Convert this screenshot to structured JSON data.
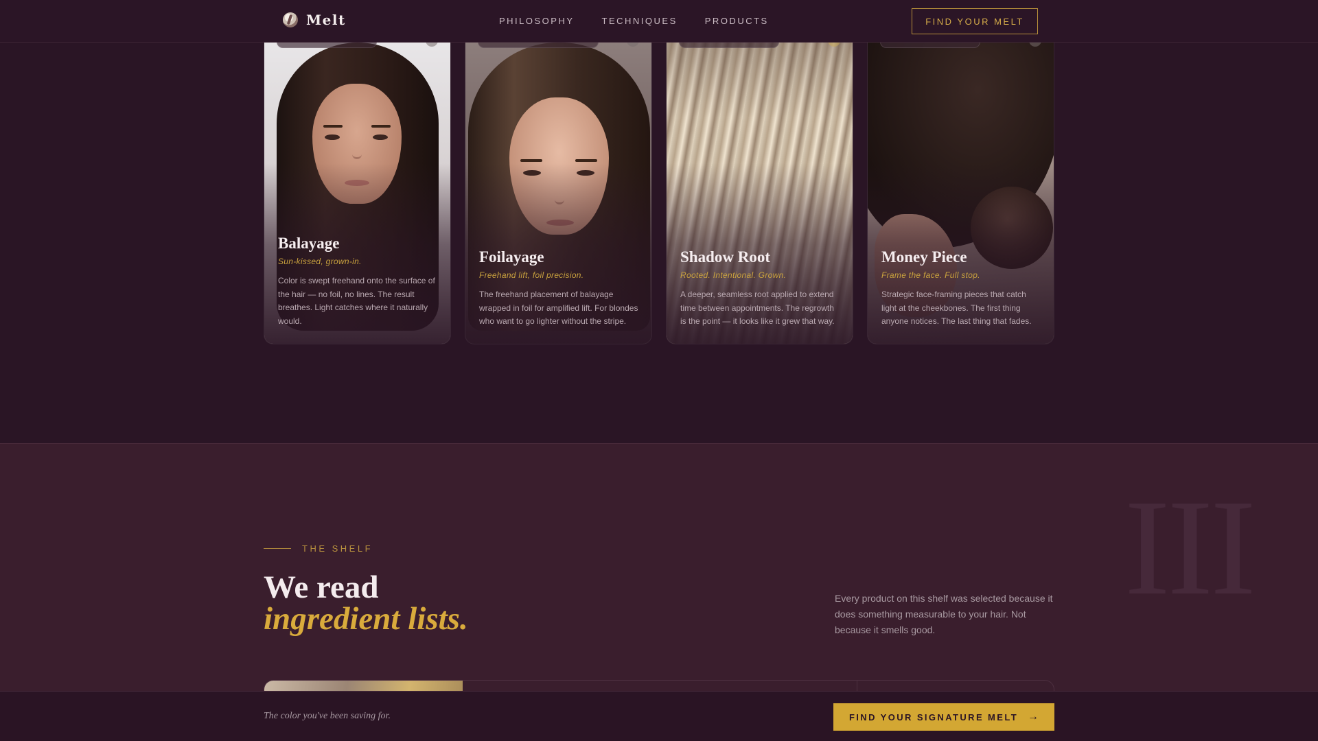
{
  "brand": {
    "name": "Melt",
    "logo_icon": "melt-flame-logo"
  },
  "nav": {
    "links": [
      "PHILOSOPHY",
      "TECHNIQUES",
      "PRODUCTS"
    ],
    "cta": "FIND YOUR MELT"
  },
  "techniques": [
    {
      "title": "Balayage",
      "subtitle": "Sun-kissed, grown-in.",
      "description": "Color is swept freehand onto the surface of the hair — no foil, no lines. The result breathes. Light catches where it naturally would."
    },
    {
      "title": "Foilayage",
      "subtitle": "Freehand lift, foil precision.",
      "description": "The freehand placement of balayage wrapped in foil for amplified lift. For blondes who want to go lighter without the stripe."
    },
    {
      "title": "Shadow Root",
      "subtitle": "Rooted. Intentional. Grown.",
      "description": "A deeper, seamless root applied to extend time between appointments. The regrowth is the point — it looks like it grew that way."
    },
    {
      "title": "Money Piece",
      "subtitle": "Frame the face. Full stop.",
      "description": "Strategic face-framing pieces that catch light at the cheekbones. The first thing anyone notices. The last thing that fades."
    }
  ],
  "shelf": {
    "numeral": "III",
    "eyebrow": "THE SHELF",
    "title_line1": "We read",
    "title_line2": "ingredient lists.",
    "description": "Every product on this shelf was selected because it does something measurable to your hair. Not because it smells good."
  },
  "sticky_bar": {
    "tagline": "The color you've been saving for.",
    "cta": "FIND YOUR SIGNATURE MELT",
    "cta_icon": "arrow-right-icon",
    "arrow": "→"
  },
  "colors": {
    "background": "#2a1525",
    "section": "#3a1e2d",
    "accent_gold": "#d3a733",
    "text": "#efe6ea"
  }
}
